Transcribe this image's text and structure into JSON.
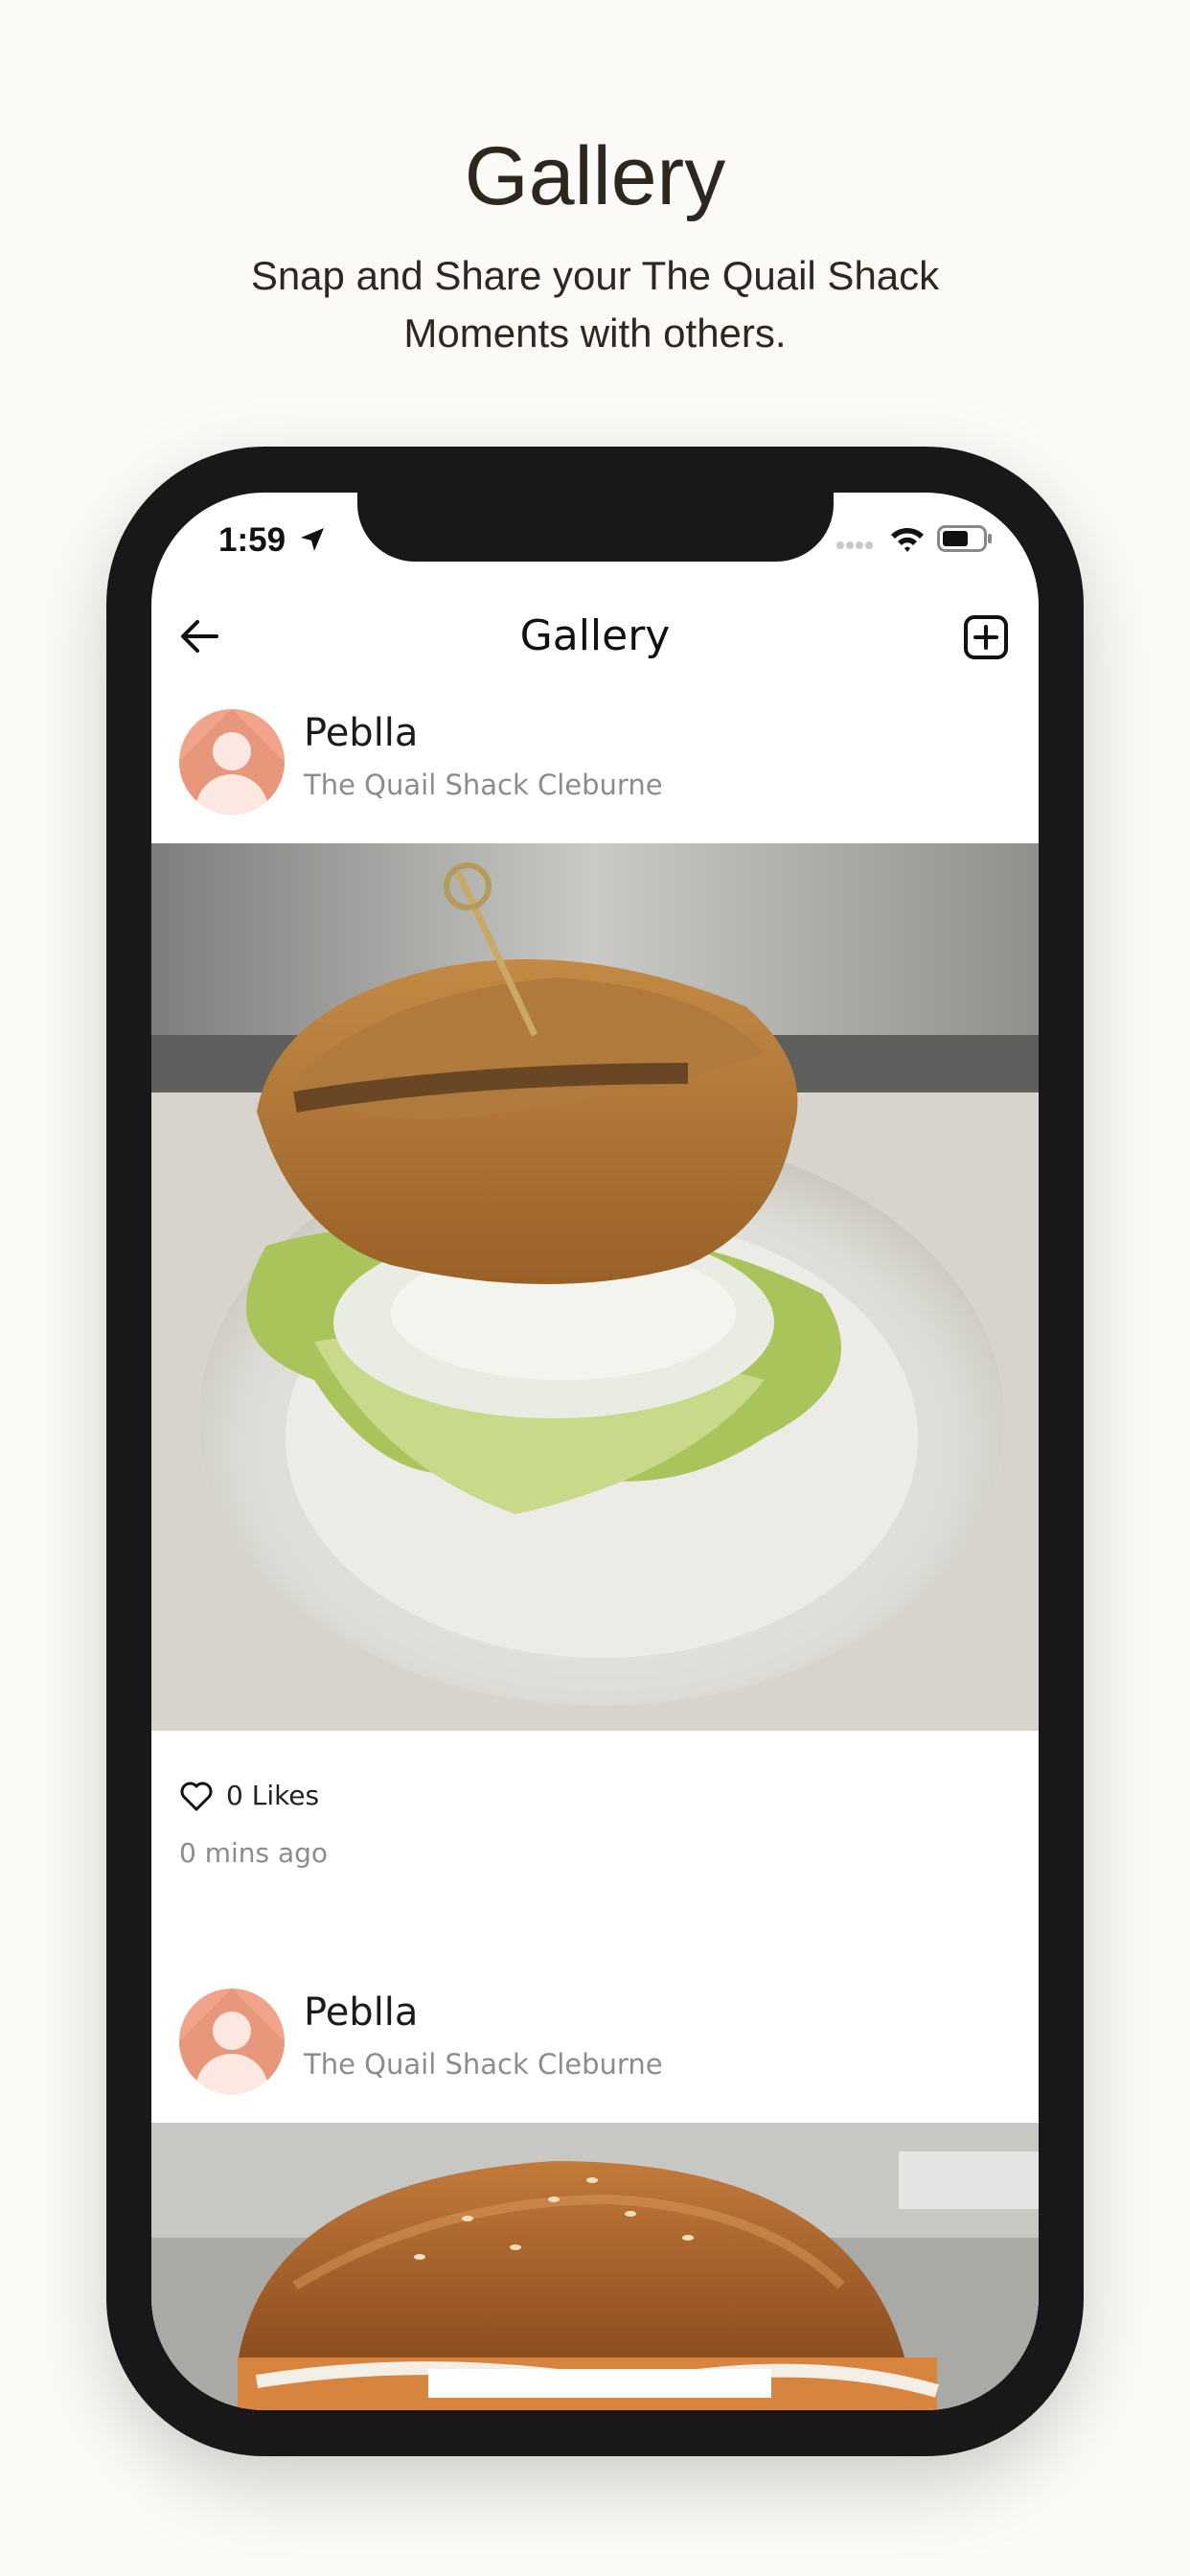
{
  "promo": {
    "title": "Gallery",
    "subtitle": "Snap and Share your The Quail Shack Moments with others."
  },
  "status_bar": {
    "time": "1:59",
    "icons": [
      "location-arrow-icon",
      "signal-icon",
      "wifi-icon",
      "battery-icon"
    ]
  },
  "nav": {
    "title": "Gallery",
    "back_icon": "arrow-left-icon",
    "add_icon": "plus-square-icon"
  },
  "posts": [
    {
      "username": "Peblla",
      "location": "The Quail Shack Cleburne",
      "image": "sandwich-photo",
      "likes": "0 Likes",
      "time": "0 mins ago"
    },
    {
      "username": "Peblla",
      "location": "The Quail Shack Cleburne",
      "image": "burger-photo"
    }
  ],
  "colors": {
    "background": "#fcfaf6",
    "phone_frame": "#1a1718",
    "avatar": "#f2a48a",
    "text_dark": "#1b1b1b",
    "text_muted": "#8c8c8c"
  }
}
